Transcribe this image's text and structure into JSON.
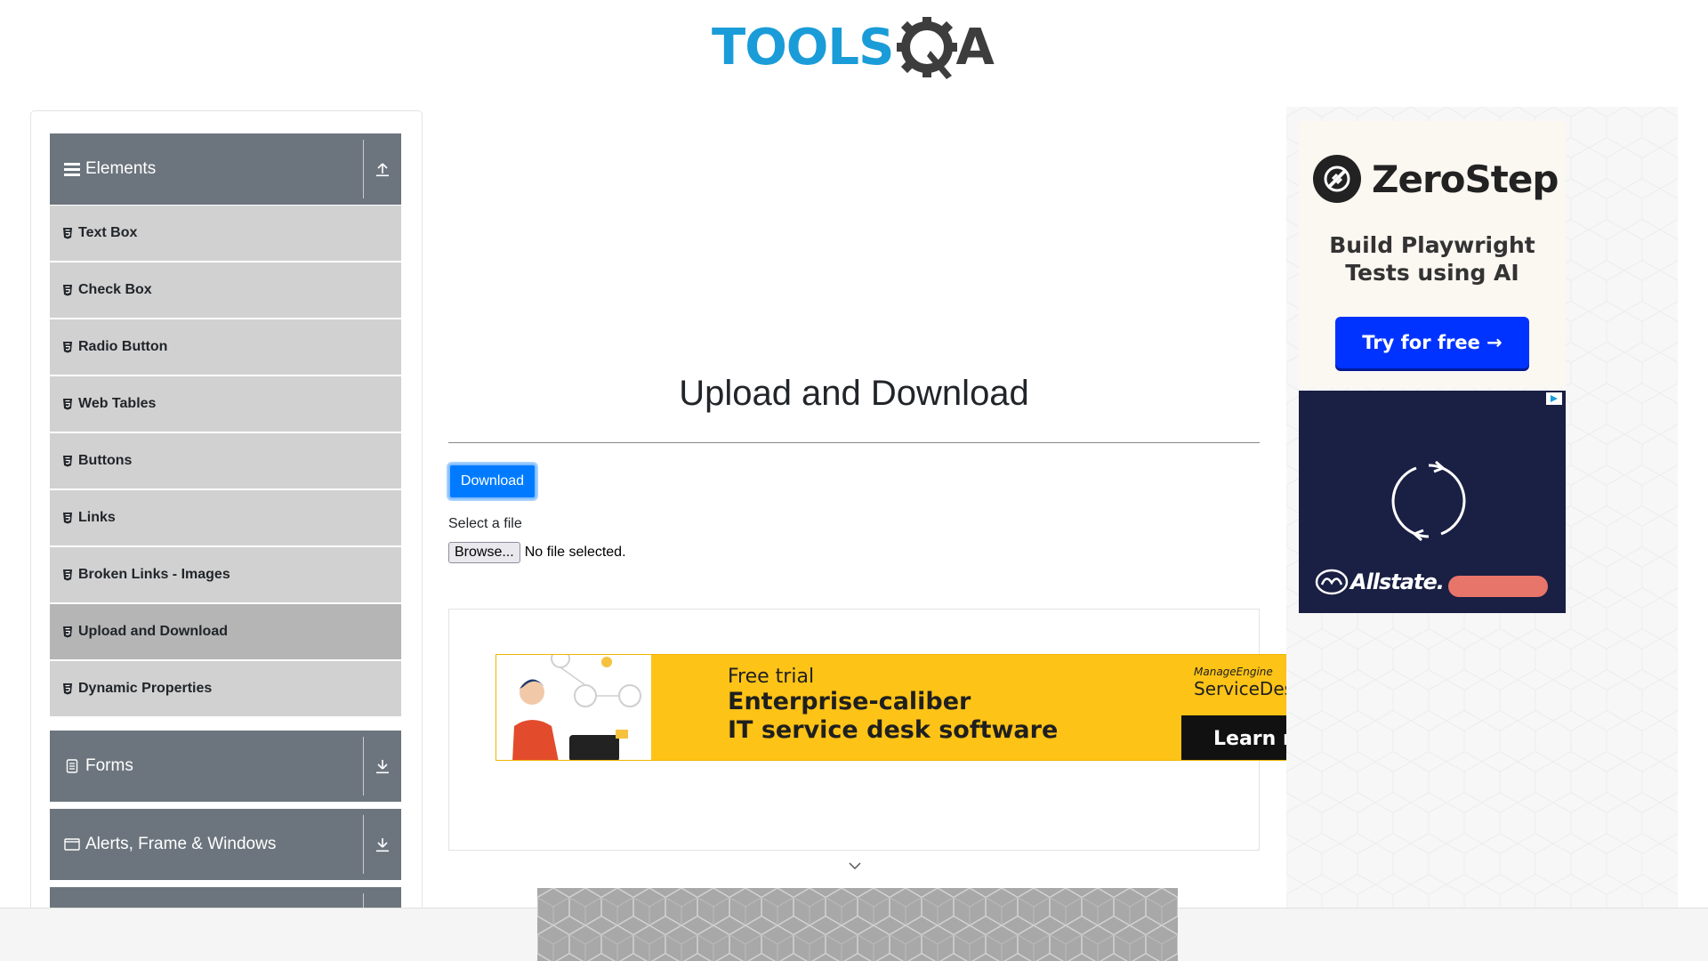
{
  "logo": {
    "part1": "TOOLS",
    "part2": "A"
  },
  "sidebar": {
    "groups": [
      {
        "label": "Elements",
        "icon": "menu-icon",
        "toggle_icon": "collapse-up-icon"
      },
      {
        "label": "Forms",
        "icon": "document-icon",
        "toggle_icon": "expand-down-icon"
      },
      {
        "label": "Alerts, Frame & Windows",
        "icon": "window-icon",
        "toggle_icon": "expand-down-icon"
      }
    ],
    "items": [
      {
        "label": "Text Box"
      },
      {
        "label": "Check Box"
      },
      {
        "label": "Radio Button"
      },
      {
        "label": "Web Tables"
      },
      {
        "label": "Buttons"
      },
      {
        "label": "Links"
      },
      {
        "label": "Broken Links - Images"
      },
      {
        "label": "Upload and Download",
        "active": true
      },
      {
        "label": "Dynamic Properties"
      }
    ]
  },
  "main": {
    "title": "Upload and Download",
    "download_label": "Download",
    "select_label": "Select a file",
    "browse_label": "Browse...",
    "file_status": "No file selected."
  },
  "banner_ad": {
    "small": "Free trial",
    "line1": "Enterprise-caliber",
    "line2": "IT service desk software",
    "brand_small": "ManageEngine",
    "brand": "ServiceDes",
    "cta": "Learn m"
  },
  "right_ads": {
    "zerostep": {
      "name": "ZeroStep",
      "tagline1": "Build Playwright",
      "tagline2": "Tests using AI",
      "cta": "Try for free →"
    },
    "allstate": {
      "name": "Allstate."
    }
  },
  "colors": {
    "accent": "#007bff",
    "sidebar_header": "#6c757d",
    "menu_item": "#d1d1d1",
    "logo_blue": "#1a9cd8"
  }
}
